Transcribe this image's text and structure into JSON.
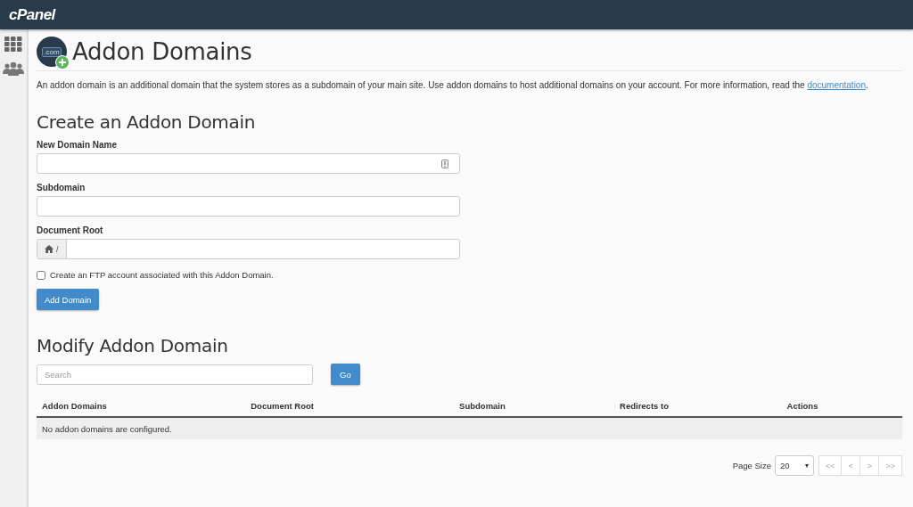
{
  "topbar": {
    "brand": "cPanel"
  },
  "sidebar": {
    "items": [
      {
        "kind": "grid"
      },
      {
        "kind": "users"
      }
    ]
  },
  "page": {
    "icon_text": ".com",
    "title": "Addon Domains",
    "description": "An addon domain is an additional domain that the system stores as a subdomain of your main site. Use addon domains to host additional domains on your account. For more information, read the ",
    "description_link": "documentation",
    "description_end": "."
  },
  "create": {
    "heading": "Create an Addon Domain",
    "fields": [
      {
        "label": "New Domain Name",
        "kind": "icon"
      },
      {
        "label": "Subdomain",
        "kind": "plain"
      },
      {
        "label": "Document Root",
        "kind": "prefix",
        "prefix": "/"
      }
    ],
    "ftp_checkbox": {
      "label": "Create an FTP account associated with this Addon Domain.",
      "checked": false
    },
    "button": "Add Domain"
  },
  "modify": {
    "heading": "Modify Addon Domain",
    "search": {
      "placeholder": "Search"
    },
    "go_button": "Go",
    "table": {
      "columns": [
        "Addon Domains",
        "Document Root",
        "Subdomain",
        "Redirects to",
        "Actions"
      ],
      "empty_message": "No addon domains are configured."
    },
    "pagination": {
      "page_size_label": "Page Size",
      "page_size": "20",
      "caret": "▾",
      "buttons": [
        {
          "label": "<<",
          "disabled": true
        },
        {
          "label": "<",
          "disabled": true
        },
        {
          "label": ">",
          "disabled": true
        },
        {
          "label": ">>",
          "disabled": true
        }
      ]
    }
  }
}
